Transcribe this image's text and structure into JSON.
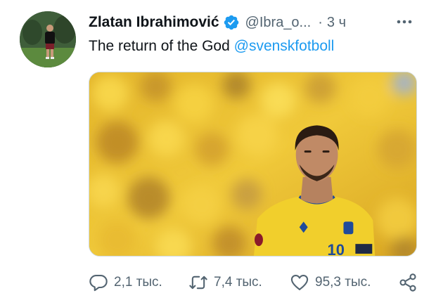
{
  "author": {
    "name": "Zlatan Ibrahimović",
    "handle": "@Ibra_o...",
    "separator": "·",
    "time": "3 ч",
    "verified_color": "#1d9bf0"
  },
  "tweet": {
    "text": "The return of the God ",
    "mention": "@svenskfotboll"
  },
  "actions": {
    "replies": "2,1 тыс.",
    "retweets": "7,4 тыс.",
    "likes": "95,3 тыс."
  },
  "icons": {
    "verified": "verified-badge-icon",
    "more": "more-options-icon",
    "reply": "reply-icon",
    "retweet": "retweet-icon",
    "like": "heart-icon",
    "share": "share-icon"
  },
  "colors": {
    "text": "#0f1419",
    "muted": "#536471",
    "accent": "#1d9bf0"
  }
}
